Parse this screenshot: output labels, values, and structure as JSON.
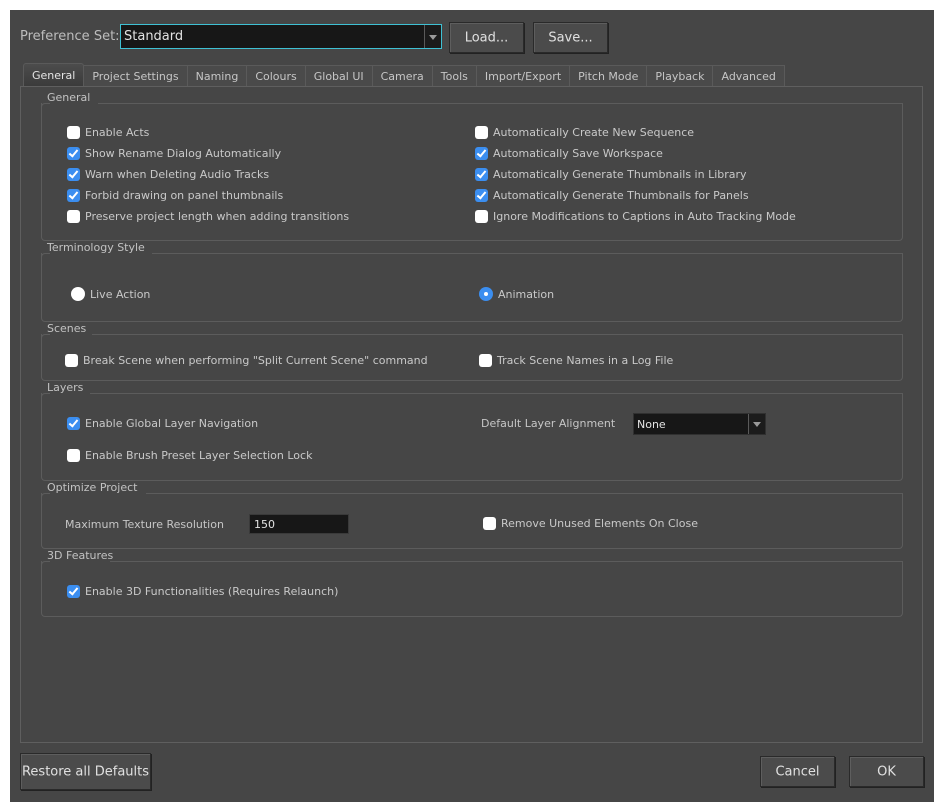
{
  "preference_set": {
    "label": "Preference Set:",
    "value": "Standard"
  },
  "buttons": {
    "load": "Load...",
    "save": "Save...",
    "restore": "Restore all Defaults",
    "cancel": "Cancel",
    "ok": "OK"
  },
  "tabs": [
    {
      "label": "General",
      "active": true
    },
    {
      "label": "Project Settings",
      "active": false
    },
    {
      "label": "Naming",
      "active": false
    },
    {
      "label": "Colours",
      "active": false
    },
    {
      "label": "Global UI",
      "active": false
    },
    {
      "label": "Camera",
      "active": false
    },
    {
      "label": "Tools",
      "active": false
    },
    {
      "label": "Import/Export",
      "active": false
    },
    {
      "label": "Pitch Mode",
      "active": false
    },
    {
      "label": "Playback",
      "active": false
    },
    {
      "label": "Advanced",
      "active": false
    }
  ],
  "general": {
    "title": "General",
    "left": [
      {
        "label": "Enable Acts",
        "checked": false
      },
      {
        "label": "Show Rename Dialog Automatically",
        "checked": true
      },
      {
        "label": "Warn when Deleting Audio Tracks",
        "checked": true
      },
      {
        "label": "Forbid drawing on panel thumbnails",
        "checked": true
      },
      {
        "label": "Preserve project length when adding transitions",
        "checked": false
      }
    ],
    "right": [
      {
        "label": "Automatically Create New Sequence",
        "checked": false
      },
      {
        "label": "Automatically Save Workspace",
        "checked": true
      },
      {
        "label": "Automatically Generate Thumbnails in Library",
        "checked": true
      },
      {
        "label": "Automatically Generate Thumbnails for Panels",
        "checked": true
      },
      {
        "label": "Ignore Modifications to Captions in Auto Tracking Mode",
        "checked": false
      }
    ]
  },
  "terminology": {
    "title": "Terminology Style",
    "options": [
      {
        "label": "Live Action",
        "selected": false
      },
      {
        "label": "Animation",
        "selected": true
      }
    ]
  },
  "scenes": {
    "title": "Scenes",
    "break_scene": {
      "label": "Break Scene when performing \"Split Current Scene\" command",
      "checked": false
    },
    "track_names": {
      "label": "Track Scene Names in a Log File",
      "checked": false
    }
  },
  "layers": {
    "title": "Layers",
    "global_nav": {
      "label": "Enable Global Layer Navigation",
      "checked": true
    },
    "brush_lock": {
      "label": "Enable Brush Preset Layer Selection Lock",
      "checked": false
    },
    "alignment_label": "Default Layer Alignment",
    "alignment_value": "None"
  },
  "optimize": {
    "title": "Optimize Project",
    "texture_label": "Maximum Texture Resolution",
    "texture_value": "150",
    "remove_unused": {
      "label": "Remove Unused Elements On Close",
      "checked": false
    }
  },
  "features3d": {
    "title": "3D Features",
    "enable": {
      "label": "Enable 3D Functionalities (Requires Relaunch)",
      "checked": true
    }
  },
  "colors": {
    "accent": "#3b8ef0",
    "focus": "#3fc1d4",
    "background": "#464646"
  }
}
